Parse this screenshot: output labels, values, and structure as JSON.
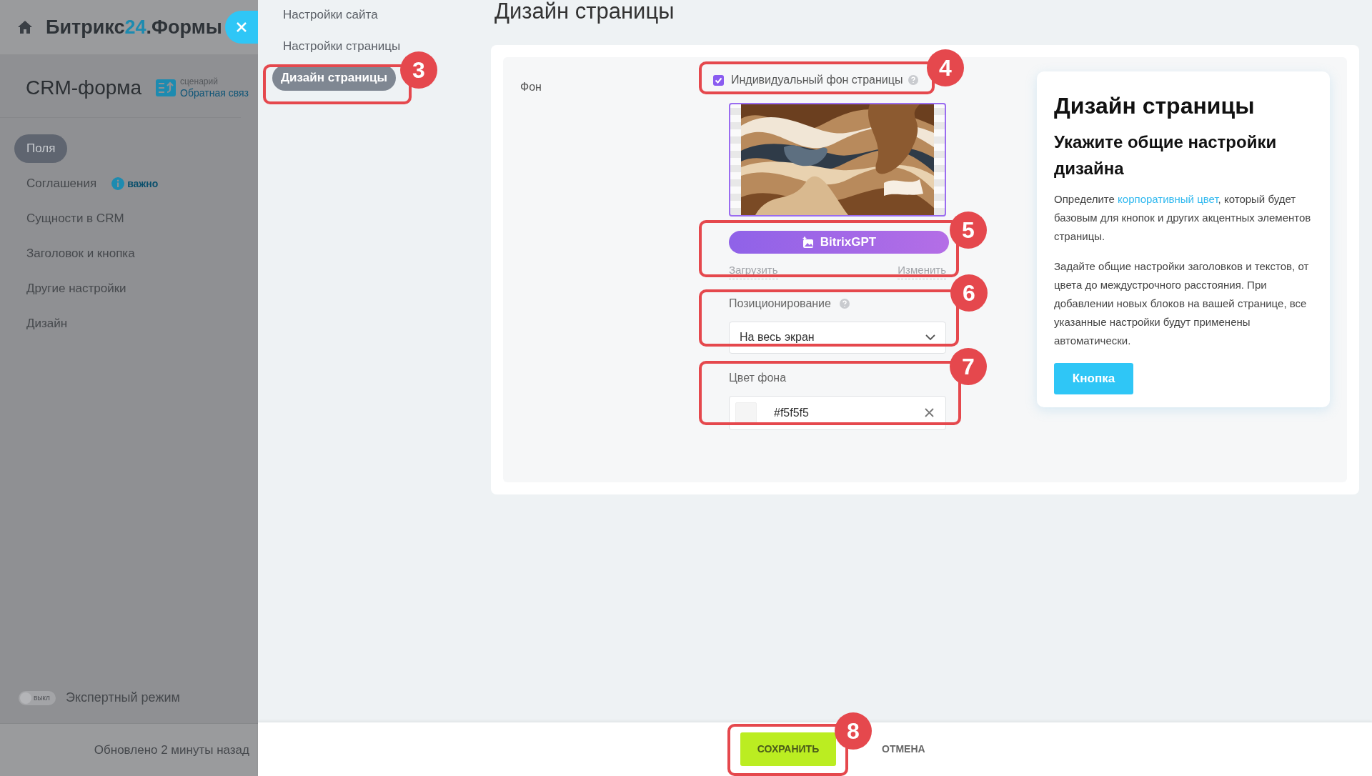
{
  "header": {
    "brand_prefix": "Битрикс",
    "brand_number": "24",
    "brand_suffix": ".Формы"
  },
  "form": {
    "title": "CRM-форма",
    "scenario_label": "сценарий",
    "scenario_value": "Обратная связ"
  },
  "sidebar": {
    "items": [
      {
        "label": "Поля",
        "selected": true
      },
      {
        "label": "Соглашения",
        "selected": false,
        "badge": "важно"
      },
      {
        "label": "Сущности в CRM",
        "selected": false
      },
      {
        "label": "Заголовок и кнопка",
        "selected": false
      },
      {
        "label": "Другие настройки",
        "selected": false
      },
      {
        "label": "Дизайн",
        "selected": false
      }
    ]
  },
  "expert_mode": {
    "label": "Экспертный режим",
    "toggle_text": "выкл",
    "on": false
  },
  "updated": "Обновлено 2 минуты назад",
  "subnav": {
    "items": [
      {
        "label": "Настройки сайта",
        "selected": false
      },
      {
        "label": "Настройки страницы",
        "selected": false
      },
      {
        "label": "Дизайн страницы",
        "selected": true
      }
    ]
  },
  "page_title": "Дизайн страницы",
  "section_label": "Фон",
  "individual_bg": {
    "label": "Индивидуальный фон страницы",
    "checked": true
  },
  "gpt_button": "BitrixGPT",
  "upload_link": "Загрузить",
  "change_link": "Изменить",
  "positioning": {
    "label": "Позиционирование",
    "value": "На весь экран"
  },
  "bg_color": {
    "label": "Цвет фона",
    "value": "#f5f5f5"
  },
  "preview": {
    "title": "Дизайн страницы",
    "subtitle": "Укажите общие настройки дизайна",
    "intro_before": "Определите ",
    "intro_link": "корпоративный цвет",
    "intro_after": ", который будет базовым для кнопок и других акцентных элементов страницы.",
    "paragraph": "Задайте общие настройки заголовков и текстов, от цвета до междустрочного расстояния. При добавлении новых блоков на вашей странице, все указанные настройки будут применены автоматически.",
    "button": "Кнопка"
  },
  "footer": {
    "save": "СОХРАНИТЬ",
    "cancel": "ОТМЕНА"
  },
  "callouts": [
    {
      "number": "3"
    },
    {
      "number": "4"
    },
    {
      "number": "5"
    },
    {
      "number": "6"
    },
    {
      "number": "7"
    },
    {
      "number": "8"
    }
  ]
}
